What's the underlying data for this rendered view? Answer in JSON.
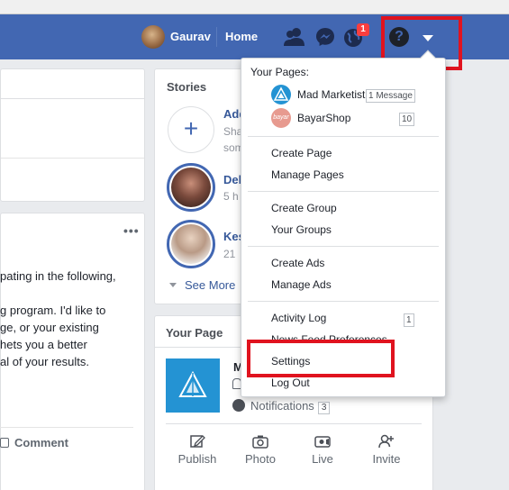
{
  "navbar": {
    "user_name": "Gaurav",
    "home_label": "Home",
    "notification_count": "1",
    "icons": [
      "friend-requests-icon",
      "messenger-icon",
      "notifications-globe-icon",
      "help-icon",
      "account-menu-caret-icon"
    ]
  },
  "post": {
    "more_label": "•••",
    "text_lines": [
      "pating in the following,",
      "",
      "g program. I'd like to",
      "ge, or your existing",
      "hets you a better",
      "al of your results."
    ],
    "comment_label": "Comment"
  },
  "stories": {
    "title": "Stories",
    "add_label": "+",
    "items": [
      {
        "name": "Add",
        "meta1": "Sha",
        "meta2": "som"
      },
      {
        "name": "Del",
        "meta1": "5 h"
      },
      {
        "name": "Kes",
        "meta1": "21"
      }
    ],
    "see_more": "See More"
  },
  "your_page": {
    "title": "Your Page",
    "name_fragment": "M",
    "notifications_label": "Notifications",
    "notifications_count": "3",
    "actions": [
      "Publish",
      "Photo",
      "Live",
      "Invite"
    ]
  },
  "dropdown": {
    "your_pages_heading": "Your Pages:",
    "pages": [
      {
        "name": "Mad Marketist",
        "badge": "1 Message",
        "avatar_color": "#2493d3"
      },
      {
        "name": "BayarShop",
        "badge": "10",
        "avatar_color": "#e79a8f",
        "avatar_text": "bayar"
      }
    ],
    "groups": [
      [
        "Create Page",
        "Manage Pages"
      ],
      [
        "Create Group",
        "Your Groups"
      ],
      [
        "Create Ads",
        "Manage Ads"
      ],
      [
        "Activity Log",
        "News Feed Preferences",
        "Settings",
        "Log Out"
      ]
    ],
    "activity_log_count": "1"
  },
  "colors": {
    "navbar_blue": "#4267b2",
    "highlight_red": "#e0131f",
    "link_blue": "#365899",
    "badge_red": "#fa3e3e"
  }
}
